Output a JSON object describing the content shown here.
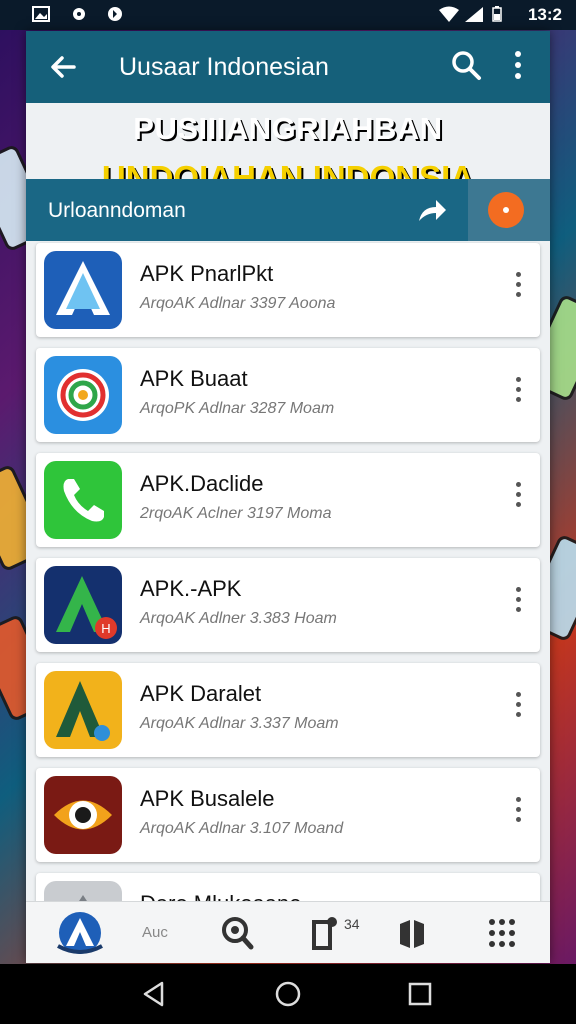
{
  "status": {
    "time": "13:2"
  },
  "toolbar": {
    "title": "Uusaar Indonesian"
  },
  "banner": {
    "line1": "PUSIIIANGRIAHBAN",
    "line2": "UNDOIAHAN INDONSIA"
  },
  "subbar": {
    "label": "Urloanndoman"
  },
  "apps": [
    {
      "name": "APK PnarlPkt",
      "meta": "ArqoAK Adlnar 3397 Aoona",
      "icon": "stylized-a-blue-icon"
    },
    {
      "name": "APK Buaat",
      "meta": "ArqoPK Adlnar 3287 Moam",
      "icon": "colorful-swirl-icon"
    },
    {
      "name": "APK.Daclide",
      "meta": "2rqoAK Aclner 3197 Moma",
      "icon": "phone-handset-icon"
    },
    {
      "name": "APK.-APK",
      "meta": "ArqoAK Adlner 3.383 Hoam",
      "icon": "green-a-icon"
    },
    {
      "name": "APK Daralet",
      "meta": "ArqoAK Adlnar 3.337 Moam",
      "icon": "yellow-a-icon"
    },
    {
      "name": "APK Busalele",
      "meta": "ArqoAK Adlnar 3.107 Moand",
      "icon": "orange-eye-icon"
    },
    {
      "name": "Daro Mlukoaane",
      "meta": "",
      "icon": "gray-app-icon"
    }
  ],
  "bottom_nav": {
    "label": "Auc",
    "badge": "34"
  },
  "colors": {
    "toolbar": "#15607a",
    "banner_yellow": "#f5d000",
    "fab": "#f36c21"
  }
}
